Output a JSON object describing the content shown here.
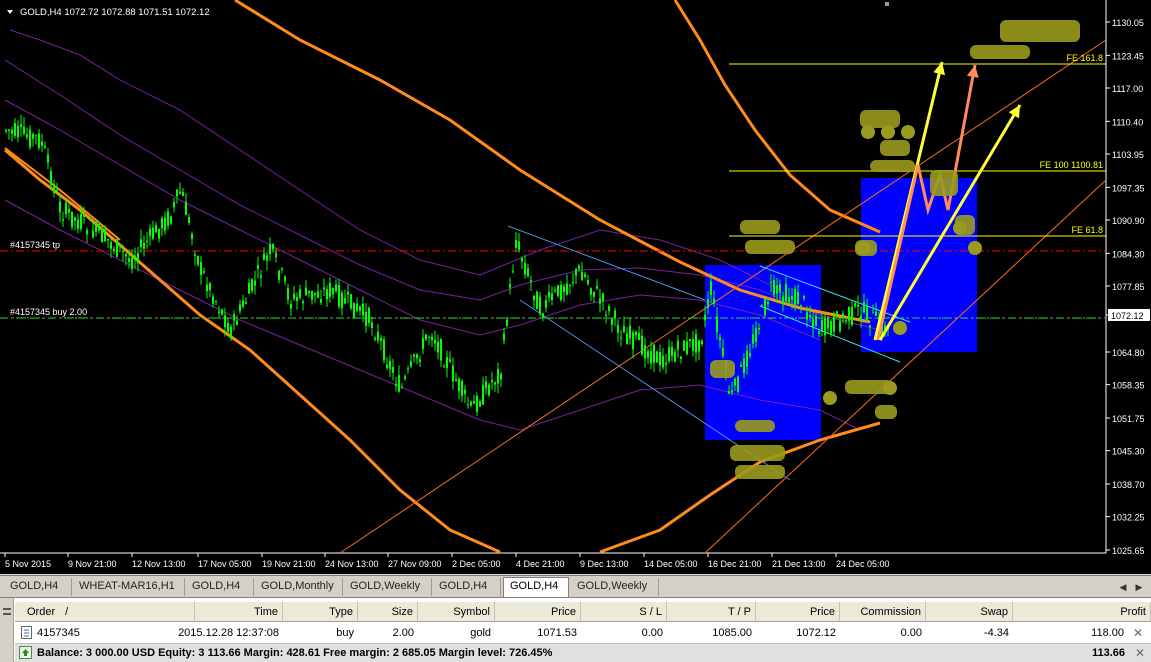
{
  "chart": {
    "title": "GOLD,H4  1072.72 1072.88 1071.51 1072.12",
    "symbol_menu_icon": "dropdown-triangle-icon",
    "price_axis": [
      "1130.05",
      "1123.45",
      "1117.00",
      "1110.40",
      "1103.95",
      "1097.35",
      "1090.90",
      "1084.30",
      "1077.85",
      "1072.12",
      "1064.80",
      "1058.35",
      "1051.75",
      "1045.30",
      "1038.70",
      "1032.25",
      "1025.65"
    ],
    "current_price": "1072.12",
    "time_axis": [
      "5 Nov 2015",
      "9 Nov 21:00",
      "12 Nov 13:00",
      "17 Nov 05:00",
      "19 Nov 21:00",
      "24 Nov 13:00",
      "27 Nov 09:00",
      "2 Dec 05:00",
      "4 Dec 21:00",
      "9 Dec 13:00",
      "14 Dec 05:00",
      "16 Dec 21:00",
      "21 Dec 13:00",
      "24 Dec 05:00"
    ],
    "order_tp_label": "#4157345 tp",
    "order_buy_label": "#4157345 buy 2.00",
    "fib_labels": [
      "FE 161.8",
      "FE 100 1100.81",
      "FE 61.8"
    ],
    "colors": {
      "bull_candle": "#00ff00",
      "tp_line": "#ff0000",
      "entry_line": "#00ff00",
      "ma_orange": "#ff8c1a",
      "envelope_purple": "#7b1fa2",
      "box_blue": "#0000ff",
      "fib_yellow": "#ffff00",
      "channel_blue": "#4a90e2",
      "channel_cyan": "#40e0ff",
      "annotation_olive": "#9a9a1e"
    }
  },
  "tabs": [
    {
      "label": "GOLD,H4"
    },
    {
      "label": "WHEAT-MAR16,H1"
    },
    {
      "label": "GOLD,H4"
    },
    {
      "label": "GOLD,Monthly"
    },
    {
      "label": "GOLD,Weekly"
    },
    {
      "label": "GOLD,H4"
    },
    {
      "label": "GOLD,H4",
      "active": true
    },
    {
      "label": "GOLD,Weekly"
    }
  ],
  "terminal": {
    "headers": {
      "order": "Order",
      "order_sort": "/",
      "time": "Time",
      "type": "Type",
      "size": "Size",
      "symbol": "Symbol",
      "price": "Price",
      "sl": "S / L",
      "tp": "T / P",
      "cur_price": "Price",
      "commission": "Commission",
      "swap": "Swap",
      "profit": "Profit"
    },
    "row": {
      "order": "4157345",
      "time": "2015.12.28 12:37:08",
      "type": "buy",
      "size": "2.00",
      "symbol": "gold",
      "price": "1071.53",
      "sl": "0.00",
      "tp": "1085.00",
      "cur_price": "1072.12",
      "commission": "0.00",
      "swap": "-4.34",
      "profit": "118.00"
    },
    "balance_line": "Balance: 3 000.00 USD  Equity: 3 113.66  Margin: 428.61  Free margin: 2 685.05  Margin level: 726.45%",
    "total_profit": "113.66"
  }
}
